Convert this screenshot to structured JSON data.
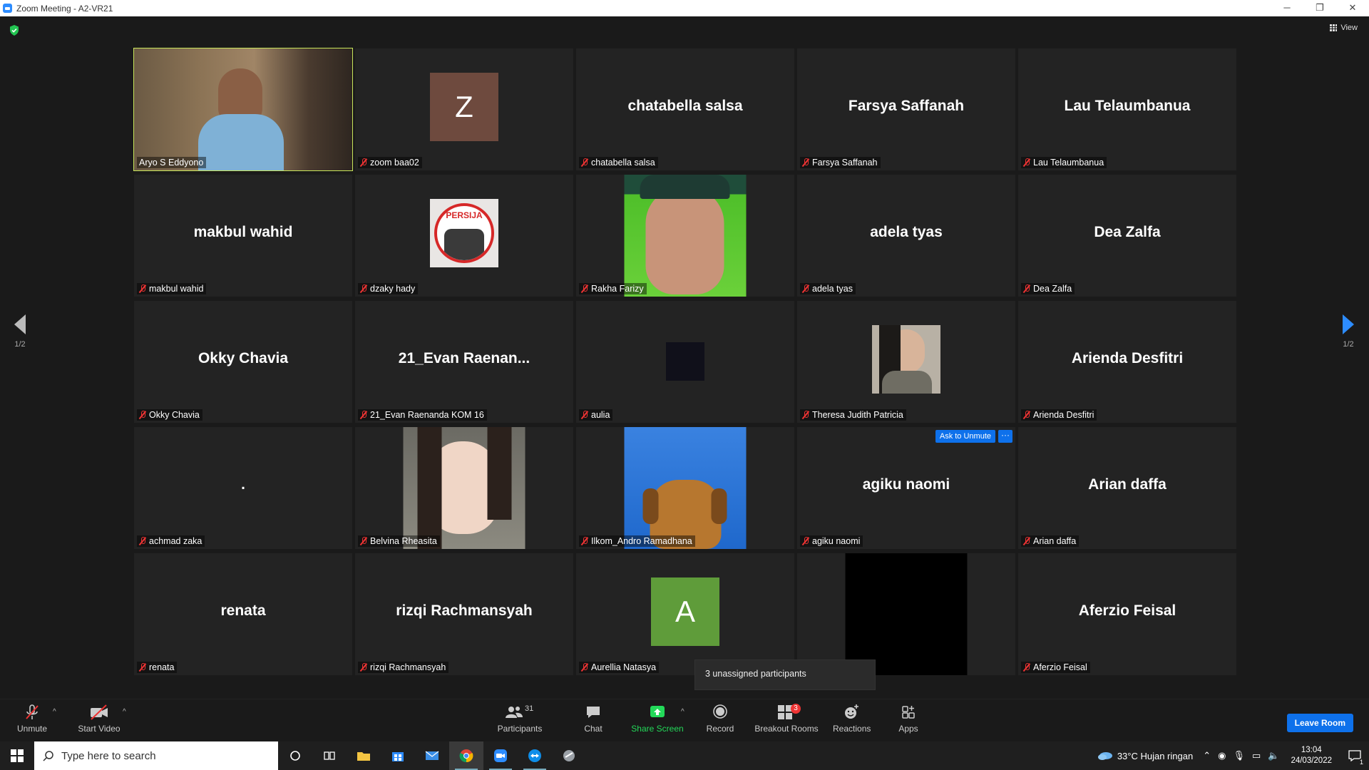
{
  "window": {
    "title": "Zoom Meeting - A2-VR21",
    "minimize": "─",
    "restore": "❐",
    "close": "✕"
  },
  "view_label": "View",
  "pager": {
    "left_label": "1/2",
    "right_label": "1/2"
  },
  "tiles": [
    {
      "name": "Aryo S Eddyono",
      "display": "",
      "muted": false,
      "kind": "video"
    },
    {
      "name": "zoom baa02",
      "display": "Z",
      "muted": true,
      "kind": "initial",
      "color": "#6e4a3e"
    },
    {
      "name": "chatabella salsa",
      "display": "chatabella salsa",
      "muted": true,
      "kind": "text"
    },
    {
      "name": "Farsya Saffanah",
      "display": "Farsya Saffanah",
      "muted": true,
      "kind": "text"
    },
    {
      "name": "Lau Telaumbanua",
      "display": "Lau Telaumbanua",
      "muted": true,
      "kind": "text"
    },
    {
      "name": "makbul wahid",
      "display": "makbul wahid",
      "muted": true,
      "kind": "text"
    },
    {
      "name": "dzaky hady",
      "display": "",
      "muted": true,
      "kind": "persija",
      "logo_text": "PERSIJA"
    },
    {
      "name": "Rakha Farizy",
      "display": "",
      "muted": true,
      "kind": "photo-green"
    },
    {
      "name": "adela tyas",
      "display": "adela tyas",
      "muted": true,
      "kind": "text"
    },
    {
      "name": "Dea Zalfa",
      "display": "Dea Zalfa",
      "muted": true,
      "kind": "text"
    },
    {
      "name": "Okky Chavia",
      "display": "Okky Chavia",
      "muted": true,
      "kind": "text"
    },
    {
      "name": "21_Evan Raenanda KOM 16",
      "display": "21_Evan  Raenan...",
      "muted": true,
      "kind": "text"
    },
    {
      "name": "aulia",
      "display": "",
      "muted": true,
      "kind": "dark-square"
    },
    {
      "name": "Theresa Judith Patricia",
      "display": "",
      "muted": true,
      "kind": "small-photo"
    },
    {
      "name": "Arienda Desfitri",
      "display": "Arienda Desfitri",
      "muted": true,
      "kind": "text"
    },
    {
      "name": "achmad zaka",
      "display": ".",
      "muted": true,
      "kind": "text"
    },
    {
      "name": "Belvina Rheasita",
      "display": "",
      "muted": true,
      "kind": "photo-portrait"
    },
    {
      "name": "Ilkom_Andro Ramadhana",
      "display": "",
      "muted": true,
      "kind": "photo-dog"
    },
    {
      "name": "agiku naomi",
      "display": "agiku naomi",
      "muted": true,
      "kind": "text",
      "ask_unmute": "Ask to Unmute",
      "more": "···"
    },
    {
      "name": "Arian daffa",
      "display": "Arian daffa",
      "muted": true,
      "kind": "text"
    },
    {
      "name": "renata",
      "display": "renata",
      "muted": true,
      "kind": "text"
    },
    {
      "name": "rizqi Rachmansyah",
      "display": "rizqi Rachmansyah",
      "muted": true,
      "kind": "text"
    },
    {
      "name": "Aurellia Natasya",
      "display": "A",
      "muted": true,
      "kind": "initial",
      "color": "#5f9c3a"
    },
    {
      "name": "",
      "display": "",
      "muted": false,
      "kind": "black"
    },
    {
      "name": "Aferzio Feisal",
      "display": "Aferzio Feisal",
      "muted": true,
      "kind": "text"
    }
  ],
  "tooltip": "3 unassigned participants",
  "toolbar": {
    "unmute": "Unmute",
    "start_video": "Start Video",
    "participants": "Participants",
    "participants_count": "31",
    "chat": "Chat",
    "share_screen": "Share Screen",
    "record": "Record",
    "breakout_rooms": "Breakout Rooms",
    "breakout_badge": "3",
    "reactions": "Reactions",
    "apps": "Apps",
    "leave": "Leave Room"
  },
  "taskbar": {
    "search_placeholder": "Type here to search",
    "weather": "33°C  Hujan ringan",
    "time": "13:04",
    "date": "24/03/2022",
    "notif": "1"
  },
  "colors": {
    "accent": "#0e71eb",
    "active_border": "#c8e65b",
    "share_green": "#23d959",
    "mute_red": "#e33"
  }
}
